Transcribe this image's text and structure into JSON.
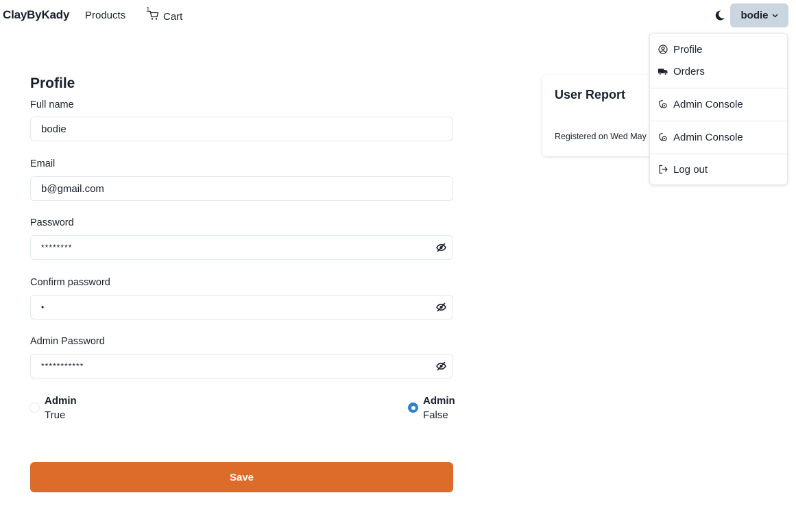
{
  "nav": {
    "brand": "ClayByKady",
    "products": "Products",
    "cart_label": "Cart",
    "cart_count": "1",
    "user": "bodie"
  },
  "menu": {
    "items": [
      {
        "label": "Profile",
        "icon": "user-circle-icon"
      },
      {
        "label": "Orders",
        "icon": "truck-icon"
      },
      {
        "label": "Admin Console",
        "icon": "admin-console-icon"
      },
      {
        "label": "Admin Console",
        "icon": "admin-console-icon"
      },
      {
        "label": "Log out",
        "icon": "logout-icon"
      }
    ]
  },
  "report": {
    "title": "User Report",
    "registered": "Registered on Wed May"
  },
  "form": {
    "title": "Profile",
    "full_name_label": "Full name",
    "full_name_value": "bodie",
    "email_label": "Email",
    "email_value": "b@gmail.com",
    "password_label": "Password",
    "password_value": "********",
    "confirm_label": "Confirm password",
    "confirm_value": "•",
    "admin_password_label": "Admin Password",
    "admin_password_value": "***********",
    "radio_true_title": "Admin",
    "radio_true_sub": "True",
    "radio_false_title": "Admin",
    "radio_false_sub": "False",
    "selected": "False",
    "save": "Save"
  },
  "colors": {
    "accent": "#dd6b2a",
    "radio_selected": "#3182ce",
    "user_button": "#cbd5e0"
  }
}
